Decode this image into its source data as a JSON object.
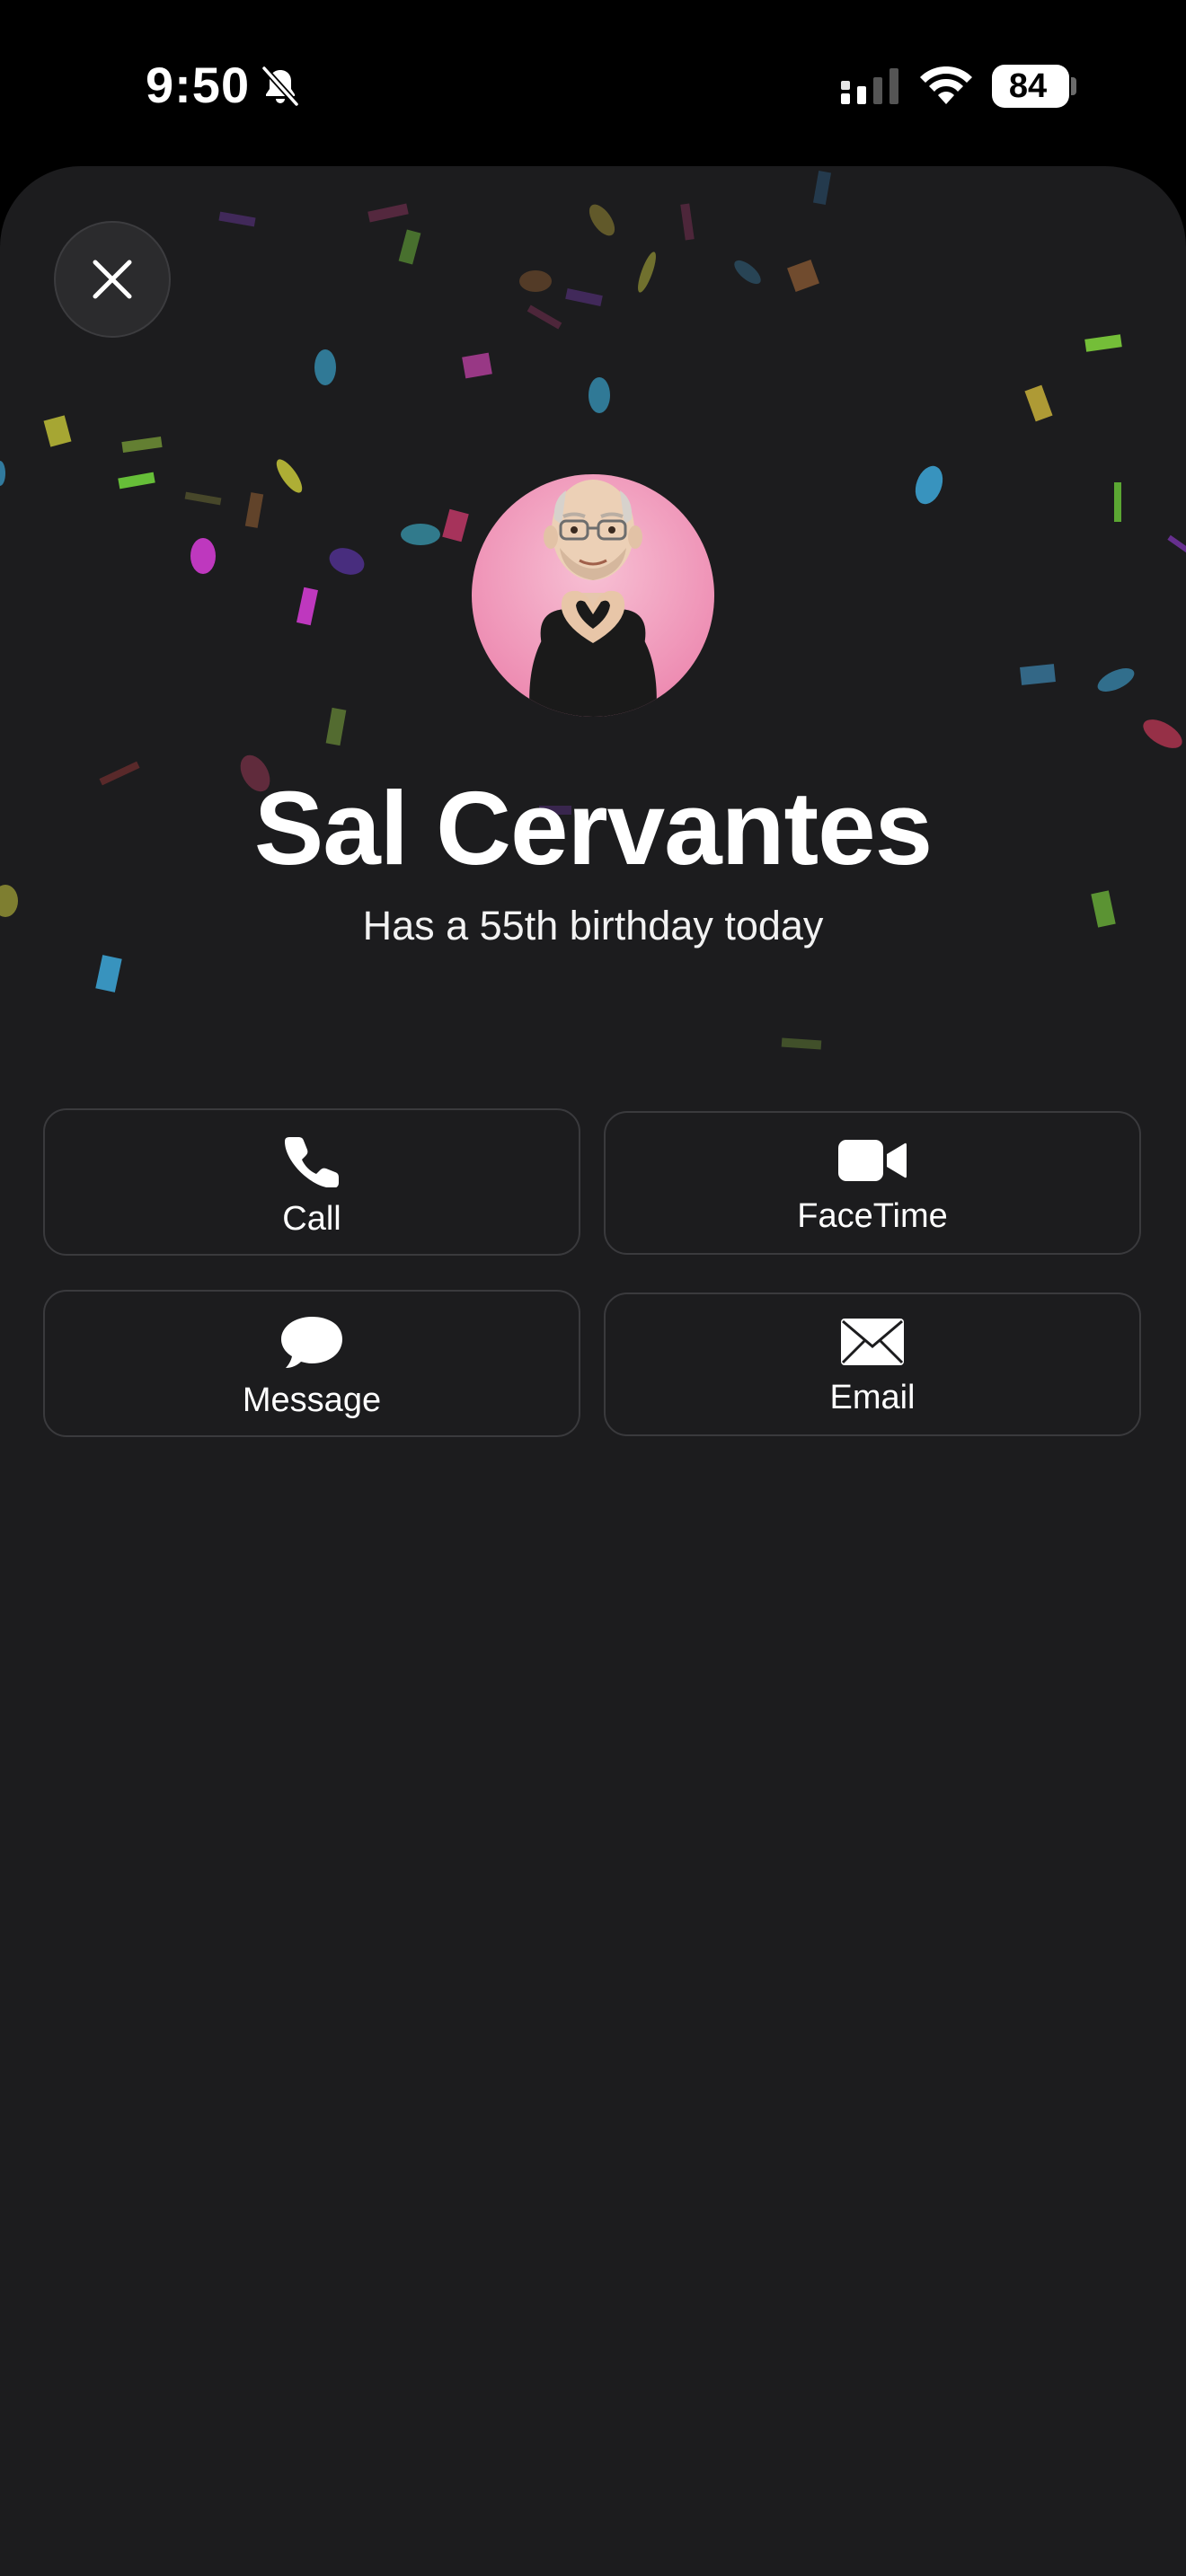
{
  "status_bar": {
    "time": "9:50",
    "battery_percent": "84",
    "battery_level": 0.84,
    "icons": [
      "bell-off-icon",
      "cellular-signal-icon",
      "wifi-icon",
      "battery-icon"
    ]
  },
  "sheet": {
    "close_icon": "close-icon",
    "contact": {
      "name": "Sal Cervantes",
      "note": "Has a 55th birthday today",
      "avatar_background": "#ee8fb4"
    },
    "actions": [
      {
        "label": "Call",
        "icon": "phone-icon"
      },
      {
        "label": "FaceTime",
        "icon": "video-camera-icon"
      },
      {
        "label": "Message",
        "icon": "message-bubble-icon"
      },
      {
        "label": "Email",
        "icon": "envelope-icon"
      }
    ]
  },
  "colors": {
    "background": "#1c1c1e",
    "status_bar": "#000000",
    "button_border": "#3a3a3d",
    "text": "#ffffff"
  }
}
